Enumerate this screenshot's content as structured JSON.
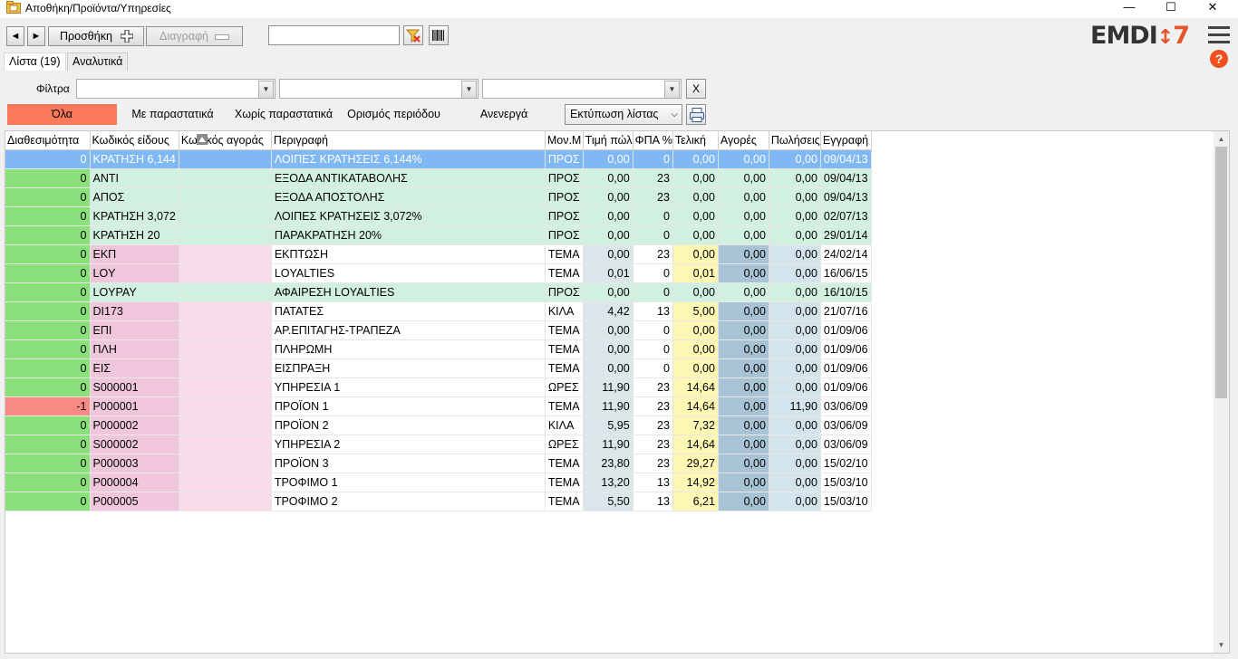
{
  "window": {
    "title": "Αποθήκη/Προϊόντα/Υπηρεσίες",
    "minimize": "—",
    "maximize": "☐",
    "close": "✕"
  },
  "toolbar": {
    "prev": "◄",
    "next": "►",
    "add_label": "Προσθήκη",
    "delete_label": "Διαγραφή",
    "search_value": "",
    "logo_text": "EMDI",
    "logo_version": "7"
  },
  "tabs": [
    {
      "label": "Λίστα (19)",
      "active": true
    },
    {
      "label": "Αναλυτικά",
      "active": false
    }
  ],
  "filters": {
    "label": "Φίλτρα",
    "combo1": "",
    "combo2": "",
    "combo3": "",
    "clear_label": "X"
  },
  "segments": [
    {
      "label": "Όλα",
      "active": true
    },
    {
      "label": "Με παραστατικά",
      "active": false
    },
    {
      "label": "Χωρίς παραστατικά",
      "active": false
    },
    {
      "label": "Ορισμός περιόδου",
      "active": false
    },
    {
      "label": "Ανενεργά",
      "active": false
    }
  ],
  "print_list": "Εκτύπωση λίστας",
  "help": "?",
  "grid": {
    "columns": [
      "Διαθεσιμότητα",
      "Κωδικός είδους",
      "Κωδικός αγοράς",
      "Περιγραφή",
      "Μον.Μ",
      "Τιμή πώλ",
      "ΦΠΑ %",
      "Τελική",
      "Αγορές",
      "Πωλήσεις",
      "Εγγραφή"
    ],
    "rows": [
      {
        "avail": "0",
        "code": "ΚΡΑΤΗΣΗ 6,144",
        "buy": "",
        "desc": "ΛΟΙΠΕΣ ΚΡΑΤΗΣΕΙΣ 6,144%",
        "unit": "ΠΡΟΣ",
        "price": "0,00",
        "vat": "0",
        "final": "0,00",
        "purch": "0,00",
        "sales": "0,00",
        "reg": "09/04/13",
        "type": "green",
        "selected": true
      },
      {
        "avail": "0",
        "code": "ΑΝΤΙ",
        "buy": "",
        "desc": "ΕΞΟΔΑ ΑΝΤΙΚΑΤΑΒΟΛΗΣ",
        "unit": "ΠΡΟΣ",
        "price": "0,00",
        "vat": "23",
        "final": "0,00",
        "purch": "0,00",
        "sales": "0,00",
        "reg": "09/04/13",
        "type": "green"
      },
      {
        "avail": "0",
        "code": "ΑΠΟΣ",
        "buy": "",
        "desc": "ΕΞΟΔΑ ΑΠΟΣΤΟΛΗΣ",
        "unit": "ΠΡΟΣ",
        "price": "0,00",
        "vat": "23",
        "final": "0,00",
        "purch": "0,00",
        "sales": "0,00",
        "reg": "09/04/13",
        "type": "green"
      },
      {
        "avail": "0",
        "code": "ΚΡΑΤΗΣΗ 3,072",
        "buy": "",
        "desc": "ΛΟΙΠΕΣ ΚΡΑΤΗΣΕΙΣ 3,072%",
        "unit": "ΠΡΟΣ",
        "price": "0,00",
        "vat": "0",
        "final": "0,00",
        "purch": "0,00",
        "sales": "0,00",
        "reg": "02/07/13",
        "type": "green"
      },
      {
        "avail": "0",
        "code": "ΚΡΑΤΗΣΗ 20",
        "buy": "",
        "desc": "ΠΑΡΑΚΡΑΤΗΣΗ 20%",
        "unit": "ΠΡΟΣ",
        "price": "0,00",
        "vat": "0",
        "final": "0,00",
        "purch": "0,00",
        "sales": "0,00",
        "reg": "29/01/14",
        "type": "green"
      },
      {
        "avail": "0",
        "code": "ΕΚΠ",
        "buy": "",
        "desc": "ΕΚΠΤΩΣΗ",
        "unit": "ΤΕΜΑ",
        "price": "0,00",
        "vat": "23",
        "final": "0,00",
        "purch": "0,00",
        "sales": "0,00",
        "reg": "24/02/14",
        "type": "item"
      },
      {
        "avail": "0",
        "code": "LOY",
        "buy": "",
        "desc": "LOYALTIES",
        "unit": "ΤΕΜΑ",
        "price": "0,01",
        "vat": "0",
        "final": "0,01",
        "purch": "0,00",
        "sales": "0,00",
        "reg": "16/06/15",
        "type": "item"
      },
      {
        "avail": "0",
        "code": "LOYPAY",
        "buy": "",
        "desc": "ΑΦΑΙΡΕΣΗ LOYALTIES",
        "unit": "ΠΡΟΣ",
        "price": "0,00",
        "vat": "0",
        "final": "0,00",
        "purch": "0,00",
        "sales": "0,00",
        "reg": "16/10/15",
        "type": "green"
      },
      {
        "avail": "0",
        "code": "DI173",
        "buy": "",
        "desc": "ΠΑΤΑΤΕΣ",
        "unit": "ΚΙΛΑ",
        "price": "4,42",
        "vat": "13",
        "final": "5,00",
        "purch": "0,00",
        "sales": "0,00",
        "reg": "21/07/16",
        "type": "item"
      },
      {
        "avail": "0",
        "code": "ΕΠΙ",
        "buy": "",
        "desc": "ΑΡ.ΕΠΙΤΑΓΗΣ-ΤΡΑΠΕΖΑ",
        "unit": "ΤΕΜΑ",
        "price": "0,00",
        "vat": "0",
        "final": "0,00",
        "purch": "0,00",
        "sales": "0,00",
        "reg": "01/09/06",
        "type": "item"
      },
      {
        "avail": "0",
        "code": "ΠΛΗ",
        "buy": "",
        "desc": "ΠΛΗΡΩΜΗ",
        "unit": "ΤΕΜΑ",
        "price": "0,00",
        "vat": "0",
        "final": "0,00",
        "purch": "0,00",
        "sales": "0,00",
        "reg": "01/09/06",
        "type": "item"
      },
      {
        "avail": "0",
        "code": "ΕΙΣ",
        "buy": "",
        "desc": "ΕΙΣΠΡΑΞΗ",
        "unit": "ΤΕΜΑ",
        "price": "0,00",
        "vat": "0",
        "final": "0,00",
        "purch": "0,00",
        "sales": "0,00",
        "reg": "01/09/06",
        "type": "item"
      },
      {
        "avail": "0",
        "code": "S000001",
        "buy": "",
        "desc": "ΥΠΗΡΕΣΙΑ 1",
        "unit": "ΩΡΕΣ",
        "price": "11,90",
        "vat": "23",
        "final": "14,64",
        "purch": "0,00",
        "sales": "0,00",
        "reg": "01/09/06",
        "type": "item"
      },
      {
        "avail": "-1",
        "code": "P000001",
        "buy": "",
        "desc": "ΠΡΟΪΟΝ 1",
        "unit": "ΤΕΜΑ",
        "price": "11,90",
        "vat": "23",
        "final": "14,64",
        "purch": "0,00",
        "sales": "11,90",
        "reg": "03/06/09",
        "type": "item",
        "negative": true
      },
      {
        "avail": "0",
        "code": "P000002",
        "buy": "",
        "desc": "ΠΡΟΪΟΝ 2",
        "unit": "ΚΙΛΑ",
        "price": "5,95",
        "vat": "23",
        "final": "7,32",
        "purch": "0,00",
        "sales": "0,00",
        "reg": "03/06/09",
        "type": "item"
      },
      {
        "avail": "0",
        "code": "S000002",
        "buy": "",
        "desc": "ΥΠΗΡΕΣΙΑ 2",
        "unit": "ΩΡΕΣ",
        "price": "11,90",
        "vat": "23",
        "final": "14,64",
        "purch": "0,00",
        "sales": "0,00",
        "reg": "03/06/09",
        "type": "item"
      },
      {
        "avail": "0",
        "code": "P000003",
        "buy": "",
        "desc": "ΠΡΟΪΟΝ 3",
        "unit": "ΤΕΜΑ",
        "price": "23,80",
        "vat": "23",
        "final": "29,27",
        "purch": "0,00",
        "sales": "0,00",
        "reg": "15/02/10",
        "type": "item"
      },
      {
        "avail": "0",
        "code": "P000004",
        "buy": "",
        "desc": "ΤΡΟΦΙΜΟ 1",
        "unit": "ΤΕΜΑ",
        "price": "13,20",
        "vat": "13",
        "final": "14,92",
        "purch": "0,00",
        "sales": "0,00",
        "reg": "15/03/10",
        "type": "item"
      },
      {
        "avail": "0",
        "code": "P000005",
        "buy": "",
        "desc": "ΤΡΟΦΙΜΟ 2",
        "unit": "ΤΕΜΑ",
        "price": "5,50",
        "vat": "13",
        "final": "6,21",
        "purch": "0,00",
        "sales": "0,00",
        "reg": "15/03/10",
        "type": "item"
      }
    ]
  },
  "colors": {
    "accent_segment": "#fb7a5b",
    "available_green": "#8be07b",
    "negative_red": "#f88a84",
    "selection_blue": "#7fb8f2",
    "logo_orange": "#e4532a"
  }
}
